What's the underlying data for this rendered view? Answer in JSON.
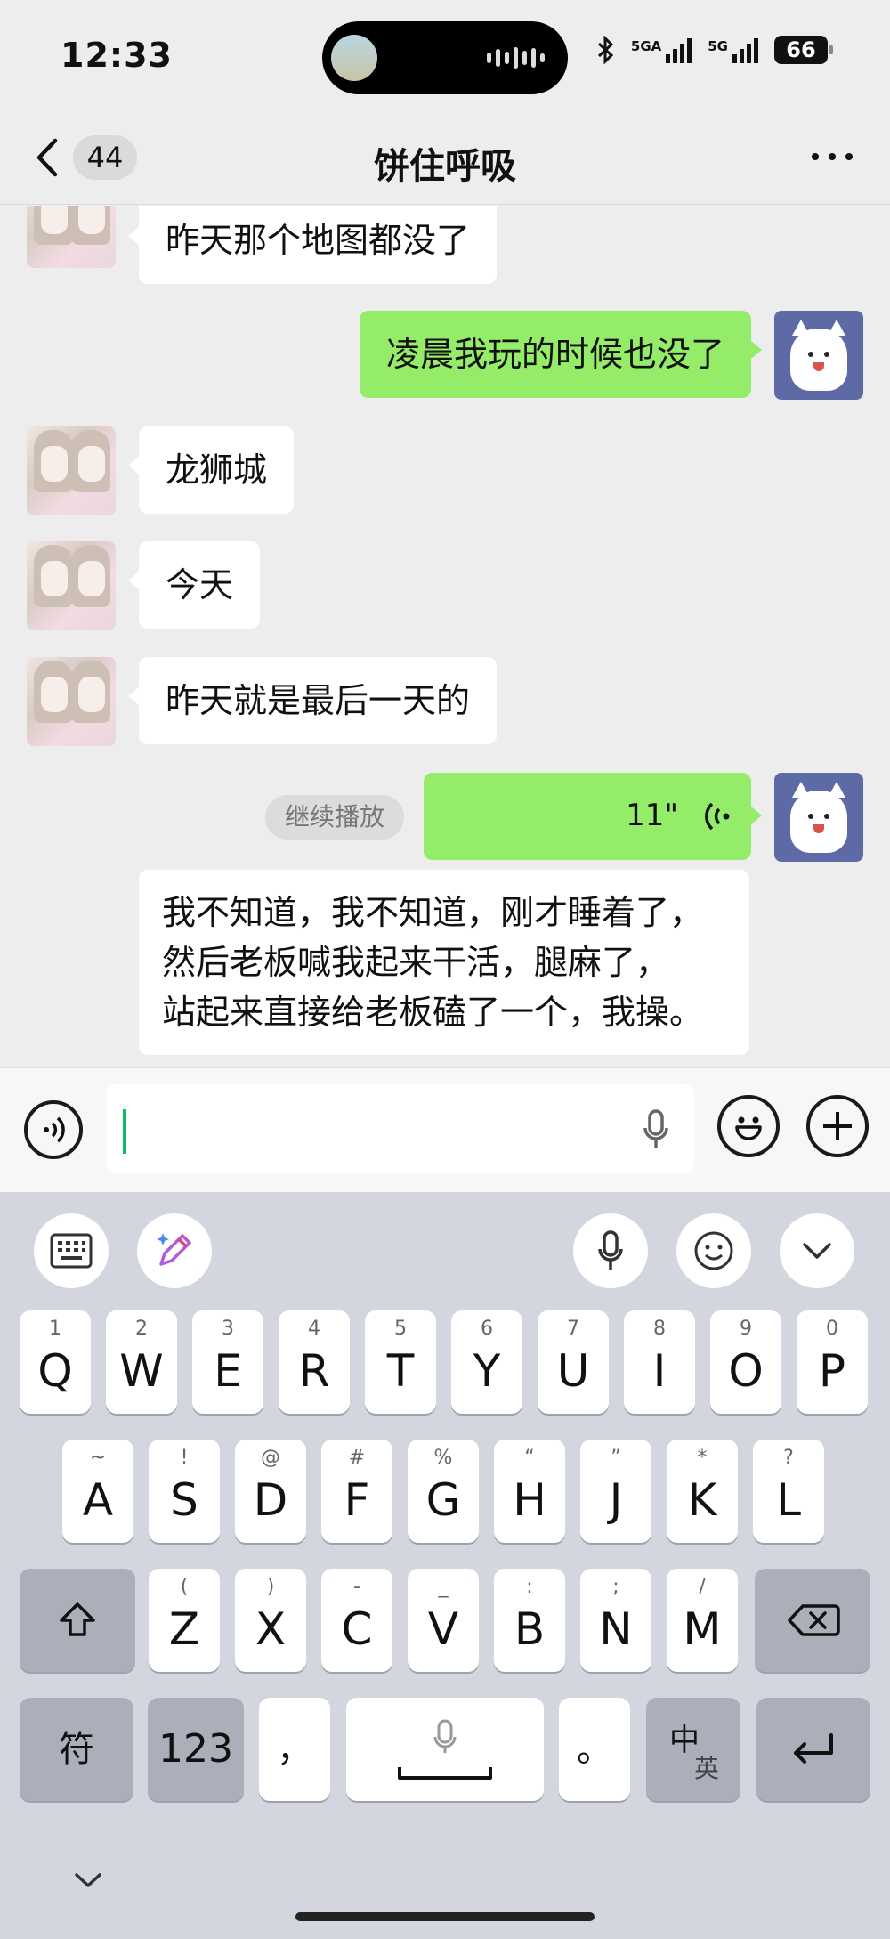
{
  "status_bar": {
    "time": "12:33",
    "signal_1": "5GA",
    "signal_2": "5G",
    "battery": "66"
  },
  "nav": {
    "back_count": "44",
    "title": "饼住呼吸"
  },
  "messages": [
    {
      "from": "other",
      "text": "昨天那个地图都没了"
    },
    {
      "from": "me",
      "text": "凌晨我玩的时候也没了"
    },
    {
      "from": "other",
      "text": "龙狮城"
    },
    {
      "from": "other",
      "text": "今天"
    },
    {
      "from": "other",
      "text": "昨天就是最后一天的"
    }
  ],
  "voice_message": {
    "duration": "11\"",
    "continue_label": "继续播放"
  },
  "transcript": {
    "line1": "我不知道，我不知道，刚才睡着了，",
    "line2": "然后老板喊我起来干活，腿麻了，",
    "line3": "站起来直接给老板磕了一个，我操。"
  },
  "input": {
    "value": ""
  },
  "keyboard": {
    "row1": [
      {
        "sub": "1",
        "key": "Q"
      },
      {
        "sub": "2",
        "key": "W"
      },
      {
        "sub": "3",
        "key": "E"
      },
      {
        "sub": "4",
        "key": "R"
      },
      {
        "sub": "5",
        "key": "T"
      },
      {
        "sub": "6",
        "key": "Y"
      },
      {
        "sub": "7",
        "key": "U"
      },
      {
        "sub": "8",
        "key": "I"
      },
      {
        "sub": "9",
        "key": "O"
      },
      {
        "sub": "0",
        "key": "P"
      }
    ],
    "row2": [
      {
        "sub": "~",
        "key": "A"
      },
      {
        "sub": "!",
        "key": "S"
      },
      {
        "sub": "@",
        "key": "D"
      },
      {
        "sub": "#",
        "key": "F"
      },
      {
        "sub": "%",
        "key": "G"
      },
      {
        "sub": "“",
        "key": "H"
      },
      {
        "sub": "”",
        "key": "J"
      },
      {
        "sub": "*",
        "key": "K"
      },
      {
        "sub": "?",
        "key": "L"
      }
    ],
    "row3": [
      {
        "sub": "(",
        "key": "Z"
      },
      {
        "sub": ")",
        "key": "X"
      },
      {
        "sub": "-",
        "key": "C"
      },
      {
        "sub": "_",
        "key": "V"
      },
      {
        "sub": ":",
        "key": "B"
      },
      {
        "sub": ";",
        "key": "N"
      },
      {
        "sub": "/",
        "key": "M"
      }
    ],
    "symbol_key": "符",
    "number_key": "123",
    "comma_key": "，",
    "period_key": "。",
    "lang_key_main": "中",
    "lang_key_sub": "英"
  },
  "colors": {
    "bubble_me": "#95ec69",
    "bubble_other": "#ffffff",
    "background": "#ededed",
    "keyboard": "#d3d6df"
  }
}
